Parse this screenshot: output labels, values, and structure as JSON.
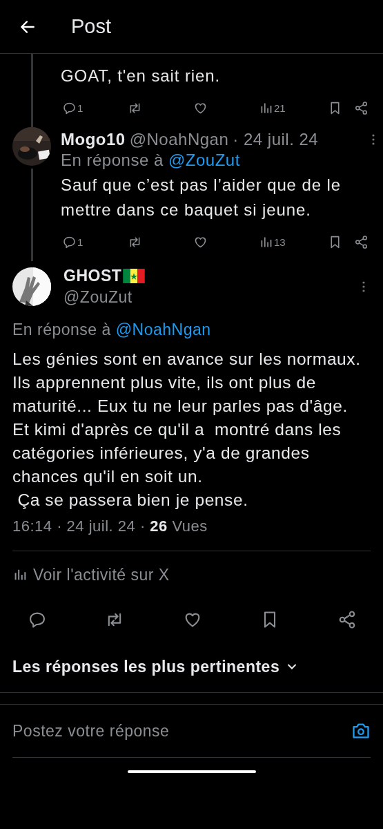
{
  "header": {
    "title": "Post"
  },
  "replies": [
    {
      "kind": "continuation",
      "text": "GOAT, t'en sait rien.",
      "actions": [
        {
          "kind": "reply",
          "count": "1"
        },
        {
          "kind": "repost"
        },
        {
          "kind": "like"
        },
        {
          "kind": "views",
          "count": "21"
        },
        {
          "kind": "bookmark"
        },
        {
          "kind": "share"
        }
      ]
    },
    {
      "kind": "reply",
      "name": "Mogo10",
      "handle": "@NoahNgan",
      "date": "· 24 juil. 24",
      "reply_prefix": "En réponse à",
      "reply_to": "@ZouZut",
      "text": "Sauf que c’est pas l’aider que de le mettre dans ce baquet si jeune.",
      "actions": [
        {
          "kind": "reply",
          "count": "1"
        },
        {
          "kind": "repost"
        },
        {
          "kind": "like"
        },
        {
          "kind": "views",
          "count": "13"
        },
        {
          "kind": "bookmark"
        },
        {
          "kind": "share"
        }
      ]
    }
  ],
  "post": {
    "name": "GHOST",
    "handle": "@ZouZut",
    "reply_prefix": "En réponse à",
    "reply_to": "@NoahNgan",
    "text": "Les génies sont en avance sur les normaux. Ils apprennent plus vite, ils ont plus de maturité... Eux tu ne leur parles pas d'âge.\nEt kimi d'après ce qu'il a  montré dans les catégories inférieures, y'a de grandes chances qu'il en soit un.\n Ça se passera bien je pense.",
    "meta": "16:14 · 24 juil. 24 · **26** Vues",
    "activity": "Voir l'activité sur X",
    "actions": [
      {
        "kind": "reply"
      },
      {
        "kind": "repost"
      },
      {
        "kind": "like"
      },
      {
        "kind": "bookmark"
      },
      {
        "kind": "share"
      }
    ]
  },
  "sort": {
    "label": "Les réponses les plus pertinentes"
  },
  "composer": {
    "placeholder": "Postez votre réponse"
  }
}
